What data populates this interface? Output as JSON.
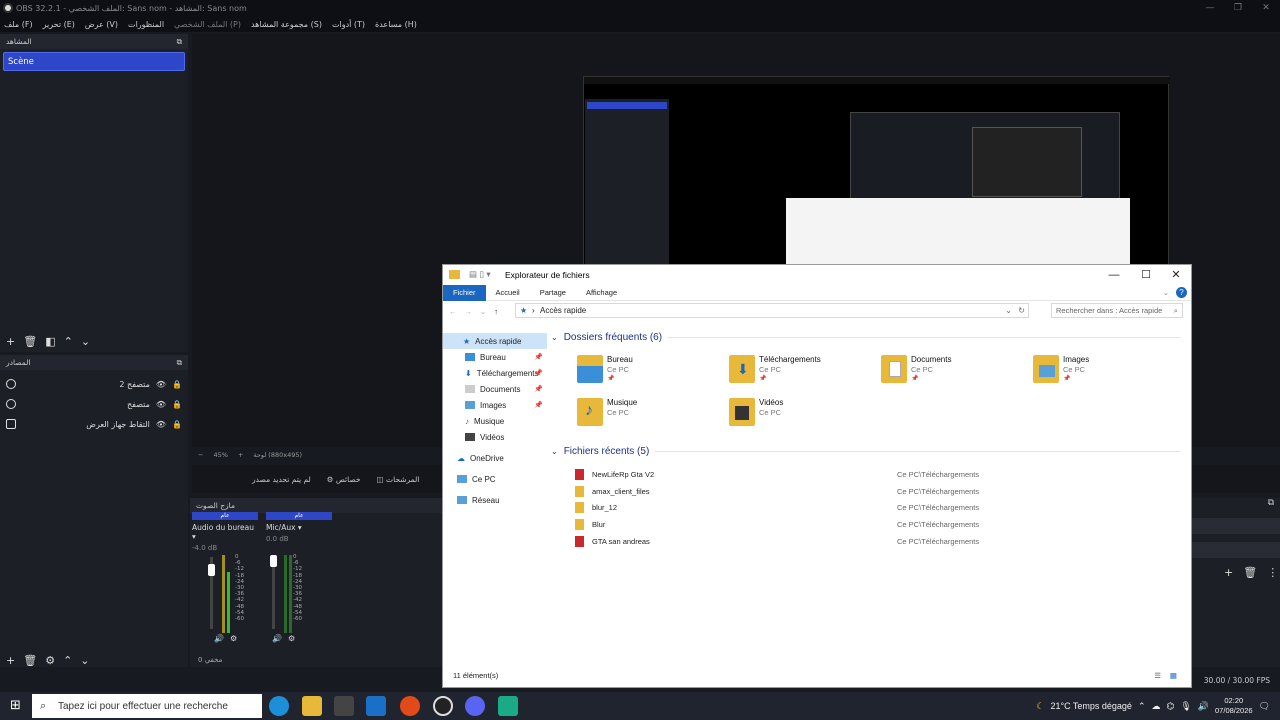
{
  "window": {
    "title": "OBS 32.2.1 - الملف الشخصي: Sans nom - المشاهد: Sans nom"
  },
  "menu": [
    {
      "label": "ملف (F)",
      "enabled": true
    },
    {
      "label": "تحرير (E)",
      "enabled": true
    },
    {
      "label": "عرض (V)",
      "enabled": true
    },
    {
      "label": "المنظورات",
      "enabled": true
    },
    {
      "label": "الملف الشخصي (P)",
      "enabled": false
    },
    {
      "label": "مجموعة المشاهد (S)",
      "enabled": true
    },
    {
      "label": "أدوات (T)",
      "enabled": true
    },
    {
      "label": "مساعدة (H)",
      "enabled": true
    }
  ],
  "scenes": {
    "title": "المشاهد",
    "items": [
      "Scène"
    ]
  },
  "sources": {
    "title": "المصادر",
    "items": [
      "متصفح 2",
      "متصفح",
      "التقاط جهاز العرض"
    ]
  },
  "preview_bar": {
    "zoom": "45%",
    "resolution": "لوحة (880x495)"
  },
  "context": {
    "no_source": "لم يتم تحديد مصدر",
    "properties": "خصائص",
    "filters": "المرشحات"
  },
  "mixer": {
    "title": "مازج الصوت",
    "channels": [
      {
        "header": "عام",
        "name": "Audio du bureau",
        "db": "-4.0 dB"
      },
      {
        "header": "عام",
        "name": "Mic/Aux",
        "db": "0.0 dB"
      }
    ],
    "scale": [
      "0",
      "-6",
      "-12",
      "-18",
      "-24",
      "-30",
      "-36",
      "-42",
      "-48",
      "-54",
      "-60"
    ],
    "footer": "مخفي 0"
  },
  "status": {
    "fps": "30.00 / 30.00 FPS"
  },
  "explorer": {
    "title": "Explorateur de fichiers",
    "ribbon": [
      "Fichier",
      "Accueil",
      "Partage",
      "Affichage"
    ],
    "address": "Accès rapide",
    "search_placeholder": "Rechercher dans : Accès rapide",
    "nav": [
      {
        "label": "Accès rapide",
        "selected": true,
        "pinned": false
      },
      {
        "label": "Bureau",
        "selected": false,
        "pinned": true
      },
      {
        "label": "Téléchargements",
        "selected": false,
        "pinned": true
      },
      {
        "label": "Documents",
        "selected": false,
        "pinned": true
      },
      {
        "label": "Images",
        "selected": false,
        "pinned": true
      },
      {
        "label": "Musique",
        "selected": false,
        "pinned": false
      },
      {
        "label": "Vidéos",
        "selected": false,
        "pinned": false
      },
      {
        "label": "OneDrive",
        "selected": false,
        "pinned": false
      },
      {
        "label": "Ce PC",
        "selected": false,
        "pinned": false
      },
      {
        "label": "Réseau",
        "selected": false,
        "pinned": false
      }
    ],
    "frequent_title": "Dossiers fréquents (6)",
    "frequent": [
      {
        "name": "Bureau",
        "sub": "Ce PC"
      },
      {
        "name": "Téléchargements",
        "sub": "Ce PC"
      },
      {
        "name": "Documents",
        "sub": "Ce PC"
      },
      {
        "name": "Images",
        "sub": "Ce PC"
      },
      {
        "name": "Musique",
        "sub": "Ce PC"
      },
      {
        "name": "Vidéos",
        "sub": "Ce PC"
      }
    ],
    "recent_title": "Fichiers récents (5)",
    "recent": [
      {
        "name": "NewLifeRp Gta V2",
        "path": "Ce PC\\Téléchargements"
      },
      {
        "name": "amax_client_files",
        "path": "Ce PC\\Téléchargements"
      },
      {
        "name": "blur_12",
        "path": "Ce PC\\Téléchargements"
      },
      {
        "name": "Blur",
        "path": "Ce PC\\Téléchargements"
      },
      {
        "name": "GTA san andreas",
        "path": "Ce PC\\Téléchargements"
      }
    ],
    "status": "11 élément(s)"
  },
  "taskbar": {
    "search_placeholder": "Tapez ici pour effectuer une recherche",
    "weather": "21°C  Temps dégagé",
    "time": "02:20",
    "date": "07/08/2026"
  }
}
